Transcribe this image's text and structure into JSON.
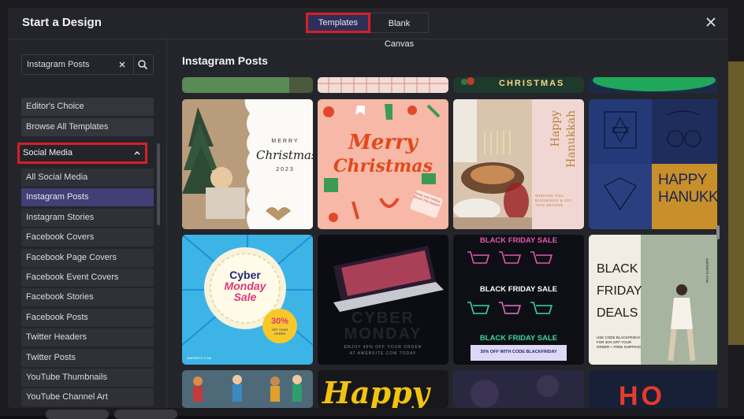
{
  "modal": {
    "title": "Start a Design",
    "tabs": [
      {
        "label": "Templates",
        "active": true
      },
      {
        "label": "Blank Canvas",
        "active": false
      }
    ],
    "close_icon": "close-icon"
  },
  "search": {
    "value": "Instagram Posts",
    "clear_icon": "×"
  },
  "sidebar": {
    "editors_choice": "Editor's Choice",
    "browse_all": "Browse All Templates",
    "section": "Social Media",
    "items": [
      {
        "label": "All Social Media",
        "selected": false
      },
      {
        "label": "Instagram Posts",
        "selected": true
      },
      {
        "label": "Instagram Stories",
        "selected": false
      },
      {
        "label": "Facebook Covers",
        "selected": false
      },
      {
        "label": "Facebook Page Covers",
        "selected": false
      },
      {
        "label": "Facebook Event Covers",
        "selected": false
      },
      {
        "label": "Facebook Stories",
        "selected": false
      },
      {
        "label": "Facebook Posts",
        "selected": false
      },
      {
        "label": "Twitter Headers",
        "selected": false
      },
      {
        "label": "Twitter Posts",
        "selected": false
      },
      {
        "label": "YouTube Thumbnails",
        "selected": false
      },
      {
        "label": "YouTube Channel Art",
        "selected": false
      }
    ]
  },
  "content": {
    "title": "Instagram Posts",
    "templates": {
      "top_row_text": "CHRISTMAS",
      "merry_christmas_photo": {
        "line1": "MERRY",
        "line2": "Christmas",
        "year": "2023"
      },
      "merry_christmas_illustration": {
        "line1": "Merry",
        "line2": "Christmas",
        "tag": "Swipe your holiday Bloom This Season"
      },
      "hanukkah_photo": {
        "line1": "Happy",
        "line2": "Hanukkah",
        "msg": "WISHING YOU BLESSINGS & JOY THIS SEASON"
      },
      "hanukkah_pattern": {
        "line1": "HAPPY",
        "line2": "HANUKKAH"
      },
      "cyber_monday_sale": {
        "line1": "Cyber",
        "line2": "Monday",
        "line3": "Sale",
        "badge": "30%",
        "badge_sub": "OFF YOUR ORDER",
        "site": "AWEBSITE.COM"
      },
      "cyber_monday_laptop": {
        "line1": "CYBER",
        "line2": "MONDAY",
        "sub": "ENJOY 40% OFF YOUR ORDER",
        "site": "AT AWEBSITE.COM TODAY"
      },
      "black_friday_carts": {
        "line1": "BLACK FRIDAY SALE",
        "line2": "BLACK FRIDAY SALE",
        "line3": "BLACK FRIDAY SALE",
        "footer": "30% OFF WITH CODE BLACKFRIDAY"
      },
      "black_friday_deals": {
        "line1": "BLACK",
        "line2": "FRIDAY",
        "line3": "DEALS",
        "code": "USE CODE BLACKFRIDAY FOR 30% OFF YOUR ORDER + FREE SHIPPING",
        "side": "AWEBSITE.COM"
      },
      "bottom_row": {
        "happy": "Happy",
        "ho": "HO"
      }
    }
  }
}
